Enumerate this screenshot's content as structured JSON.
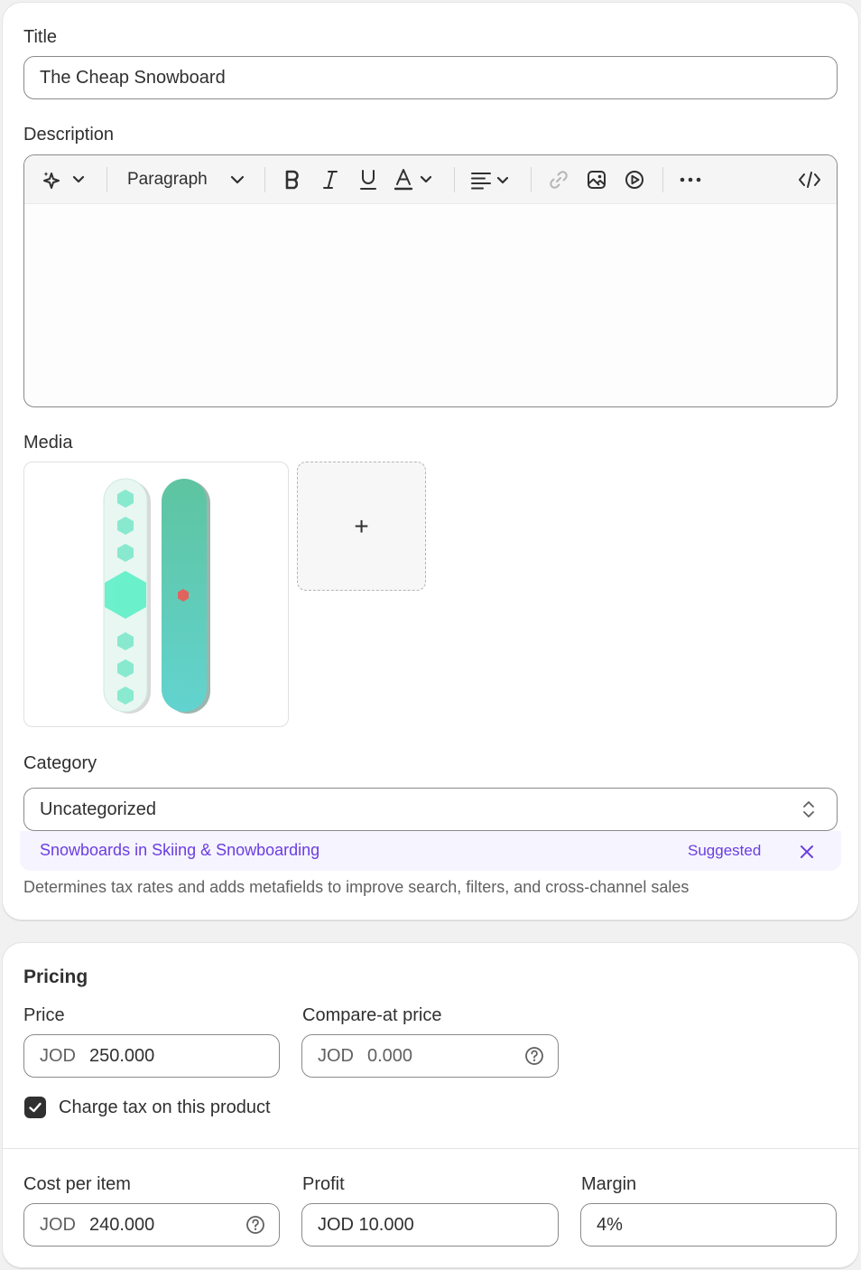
{
  "title": {
    "label": "Title",
    "value": "The Cheap Snowboard"
  },
  "description": {
    "label": "Description",
    "paragraph_select": "Paragraph",
    "toolbar_icons": [
      "magic-icon",
      "bold-icon",
      "italic-icon",
      "underline-icon",
      "text-color-icon",
      "align-icon",
      "link-icon",
      "image-icon",
      "video-icon",
      "more-icon",
      "code-icon"
    ]
  },
  "media": {
    "label": "Media",
    "add_symbol": "+"
  },
  "category": {
    "label": "Category",
    "value": "Uncategorized",
    "suggestion": "Snowboards in Skiing & Snowboarding",
    "suggestion_tag": "Suggested",
    "help": "Determines tax rates and adds metafields to improve search, filters, and cross-channel sales"
  },
  "pricing": {
    "heading": "Pricing",
    "price": {
      "label": "Price",
      "currency": "JOD",
      "value": "250.000"
    },
    "compare_at": {
      "label": "Compare-at price",
      "currency": "JOD",
      "placeholder": "0.000"
    },
    "charge_tax": {
      "label": "Charge tax on this product",
      "checked": true
    },
    "cost": {
      "label": "Cost per item",
      "currency": "JOD",
      "value": "240.000"
    },
    "profit": {
      "label": "Profit",
      "value": "JOD 10.000"
    },
    "margin": {
      "label": "Margin",
      "value": "4%"
    }
  },
  "colors": {
    "accent": "#6a3ee0",
    "checkbox": "#303030",
    "board_green": "#5cc9a0"
  }
}
